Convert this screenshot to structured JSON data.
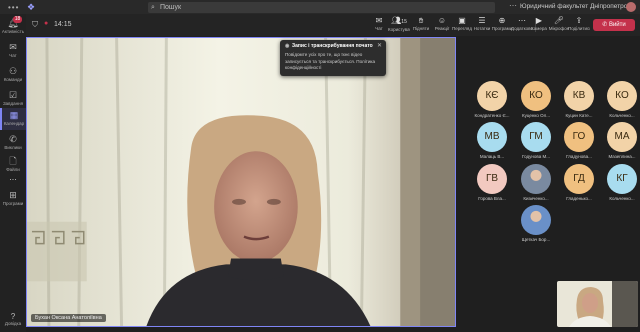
{
  "titlebar": {
    "search_placeholder": "Пошук",
    "organization": "Юридичний факультет Дніпропетровського націонал..."
  },
  "rail": {
    "items": [
      {
        "label": "Активність",
        "icon": "bell-icon",
        "badge": "18"
      },
      {
        "label": "Чат",
        "icon": "chat-icon",
        "badge": ""
      },
      {
        "label": "Команди",
        "icon": "teams-icon",
        "badge": ""
      },
      {
        "label": "Завдання",
        "icon": "assignments-icon",
        "badge": ""
      },
      {
        "label": "Календар",
        "icon": "calendar-icon",
        "badge": ""
      },
      {
        "label": "Виклики",
        "icon": "calls-icon",
        "badge": ""
      },
      {
        "label": "Файли",
        "icon": "files-icon",
        "badge": ""
      },
      {
        "label": "...",
        "icon": "more-icon",
        "badge": ""
      },
      {
        "label": "Програми",
        "icon": "apps-icon",
        "badge": ""
      }
    ],
    "help_label": "Довідка"
  },
  "toolbar": {
    "timer": "14:15",
    "buttons": [
      {
        "label": "Чат",
        "icon": "chat-icon"
      },
      {
        "label": "Користувачі",
        "icon": "people-icon",
        "count": "15"
      },
      {
        "label": "Підняти",
        "icon": "raise-hand-icon"
      },
      {
        "label": "Реакції",
        "icon": "reactions-icon"
      },
      {
        "label": "Перегляд",
        "icon": "view-icon"
      },
      {
        "label": "Нотатки",
        "icon": "notes-icon"
      },
      {
        "label": "Програми",
        "icon": "apps-icon"
      },
      {
        "label": "Додатково",
        "icon": "more-icon"
      },
      {
        "label": "Камера",
        "icon": "camera-icon"
      },
      {
        "label": "Мікрофон",
        "icon": "mic-icon"
      },
      {
        "label": "Поділитися",
        "icon": "share-icon"
      }
    ],
    "leave_label": "Вийти"
  },
  "notification": {
    "title": "Запис і транскрибування почато",
    "body": "Повідомте усіх про те, що їхнє відео записується та транскрибується. Політика конфіденційності"
  },
  "stage": {
    "speaker_name": "Бухан Оксана Анатоліївна"
  },
  "participants": [
    {
      "initials": "КЄ",
      "name": "Кондратенко Є...",
      "color": "#f2d3a8"
    },
    {
      "initials": "КО",
      "name": "Куценко Ол...",
      "color": "#f0c080"
    },
    {
      "initials": "КВ",
      "name": "Куцин Кате...",
      "color": "#f2d3a8"
    },
    {
      "initials": "КО",
      "name": "Кольченко...",
      "color": "#f2d3a8"
    },
    {
      "initials": "МВ",
      "name": "Малаць В...",
      "color": "#a8dcef"
    },
    {
      "initials": "ГМ",
      "name": "Годунова М...",
      "color": "#a8dcef"
    },
    {
      "initials": "ГО",
      "name": "Гладунова...",
      "color": "#f0c080"
    },
    {
      "initials": "МА",
      "name": "Мазеплина...",
      "color": "#f2d3a8"
    },
    {
      "initials": "ГВ",
      "name": "Горова Вла...",
      "color": "#f2c9c0"
    },
    {
      "initials": "",
      "name": "Кизиченко...",
      "color": "#7a8aa0"
    },
    {
      "initials": "ГД",
      "name": "Гладенько...",
      "color": "#f0c080"
    },
    {
      "initials": "КГ",
      "name": "Кольченко...",
      "color": "#a8dcef"
    },
    {
      "initials": "",
      "name": "Щеткач Бор...",
      "color": "#6a90c8"
    }
  ],
  "colors": {
    "accent": "#7f85f5",
    "leave": "#c4314b",
    "background": "#1f1f1f"
  }
}
